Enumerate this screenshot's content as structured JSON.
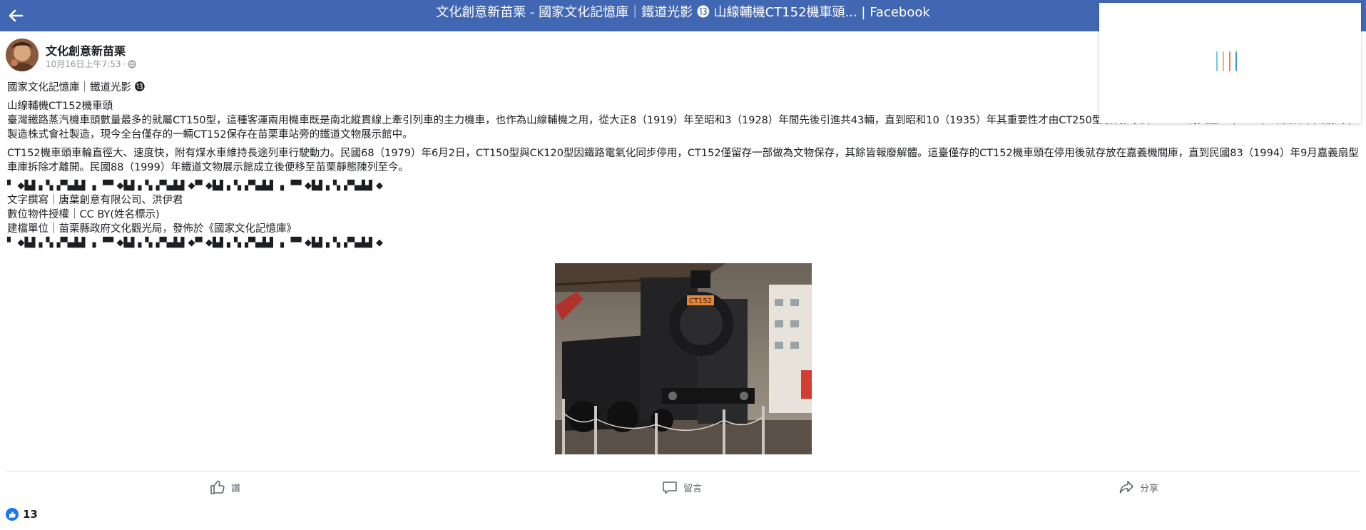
{
  "colors": {
    "topbar": "#4267b2",
    "text": "#1c1e21",
    "meta": "#90949c",
    "action": "#606770",
    "like": "#1877f2"
  },
  "header": {
    "title": "文化創意新苗栗 - 國家文化記憶庫｜鐵道光影 ⓭ 山線輔機CT152機車頭... | Facebook",
    "back_icon": "arrow-left-icon"
  },
  "loader": {
    "bar_colors": [
      "#6ecbe0",
      "#f2b84b",
      "#e7843f",
      "#3f9ad6"
    ]
  },
  "post": {
    "page_name": "文化創意新苗栗",
    "timestamp": "10月16日上午7:53",
    "separator": "·",
    "audience_icon": "globe-icon",
    "paragraphs": [
      "國家文化記憶庫｜鐵道光影 ⓭",
      "山線輔機CT152機車頭",
      "臺灣鐵路蒸汽機車頭數量最多的就屬CT150型，這種客運兩用機車既是南北縱貫線上牽引列車的主力機車，也作為山線輔機之用，從大正8（1919）年至昭和3（1928）年間先後引進共43輛，直到昭和10（1935）年其重要性才由CT250型取代。其中CT152為大正8（1919）年由日本大阪汽車製造株式會社製造，現今全台僅存的一輛CT152保存在苗栗車站旁的鐵道文物展示館中。",
      "CT152機車頭車輪直徑大、速度快，附有煤水車維持長途列車行駛動力。民國68（1979）年6月2日，CT150型與CK120型因鐵路電氣化同步停用，CT152僅留存一部做為文物保存，其餘皆報廢解體。這臺僅存的CT152機車頭在停用後就存放在嘉義機關庫，直到民國83（1994）年9月嘉義扇型車庫拆除才離開。民國88（1999）年鐵道文物展示館成立後便移至苗栗靜態陳列至今。"
    ],
    "divider": "▘ ◆▙▌▖▚▗▀▄▙▌▗ ▝▀ ◆▙▌▖▚▗▀▄▙▌◆▀ ◆▙▌▖▚▗▀▄▙▌▗ ▝▀ ◆▙▌▖▚▗▀▄▙▌◆",
    "credits": [
      "文字撰寫｜唐葉創意有限公司、洪伊君",
      "數位物件授權｜CC BY(姓名標示)",
      "建檔單位｜苗栗縣政府文化觀光局，發佈於《國家文化記憶庫》"
    ]
  },
  "actions": {
    "like": {
      "label": "讚",
      "icon": "thumbs-up-icon"
    },
    "comment": {
      "label": "留言",
      "icon": "comment-icon"
    },
    "share": {
      "label": "分享",
      "icon": "share-icon"
    }
  },
  "reactions": {
    "count": "13",
    "icon": "like-reaction-icon"
  }
}
